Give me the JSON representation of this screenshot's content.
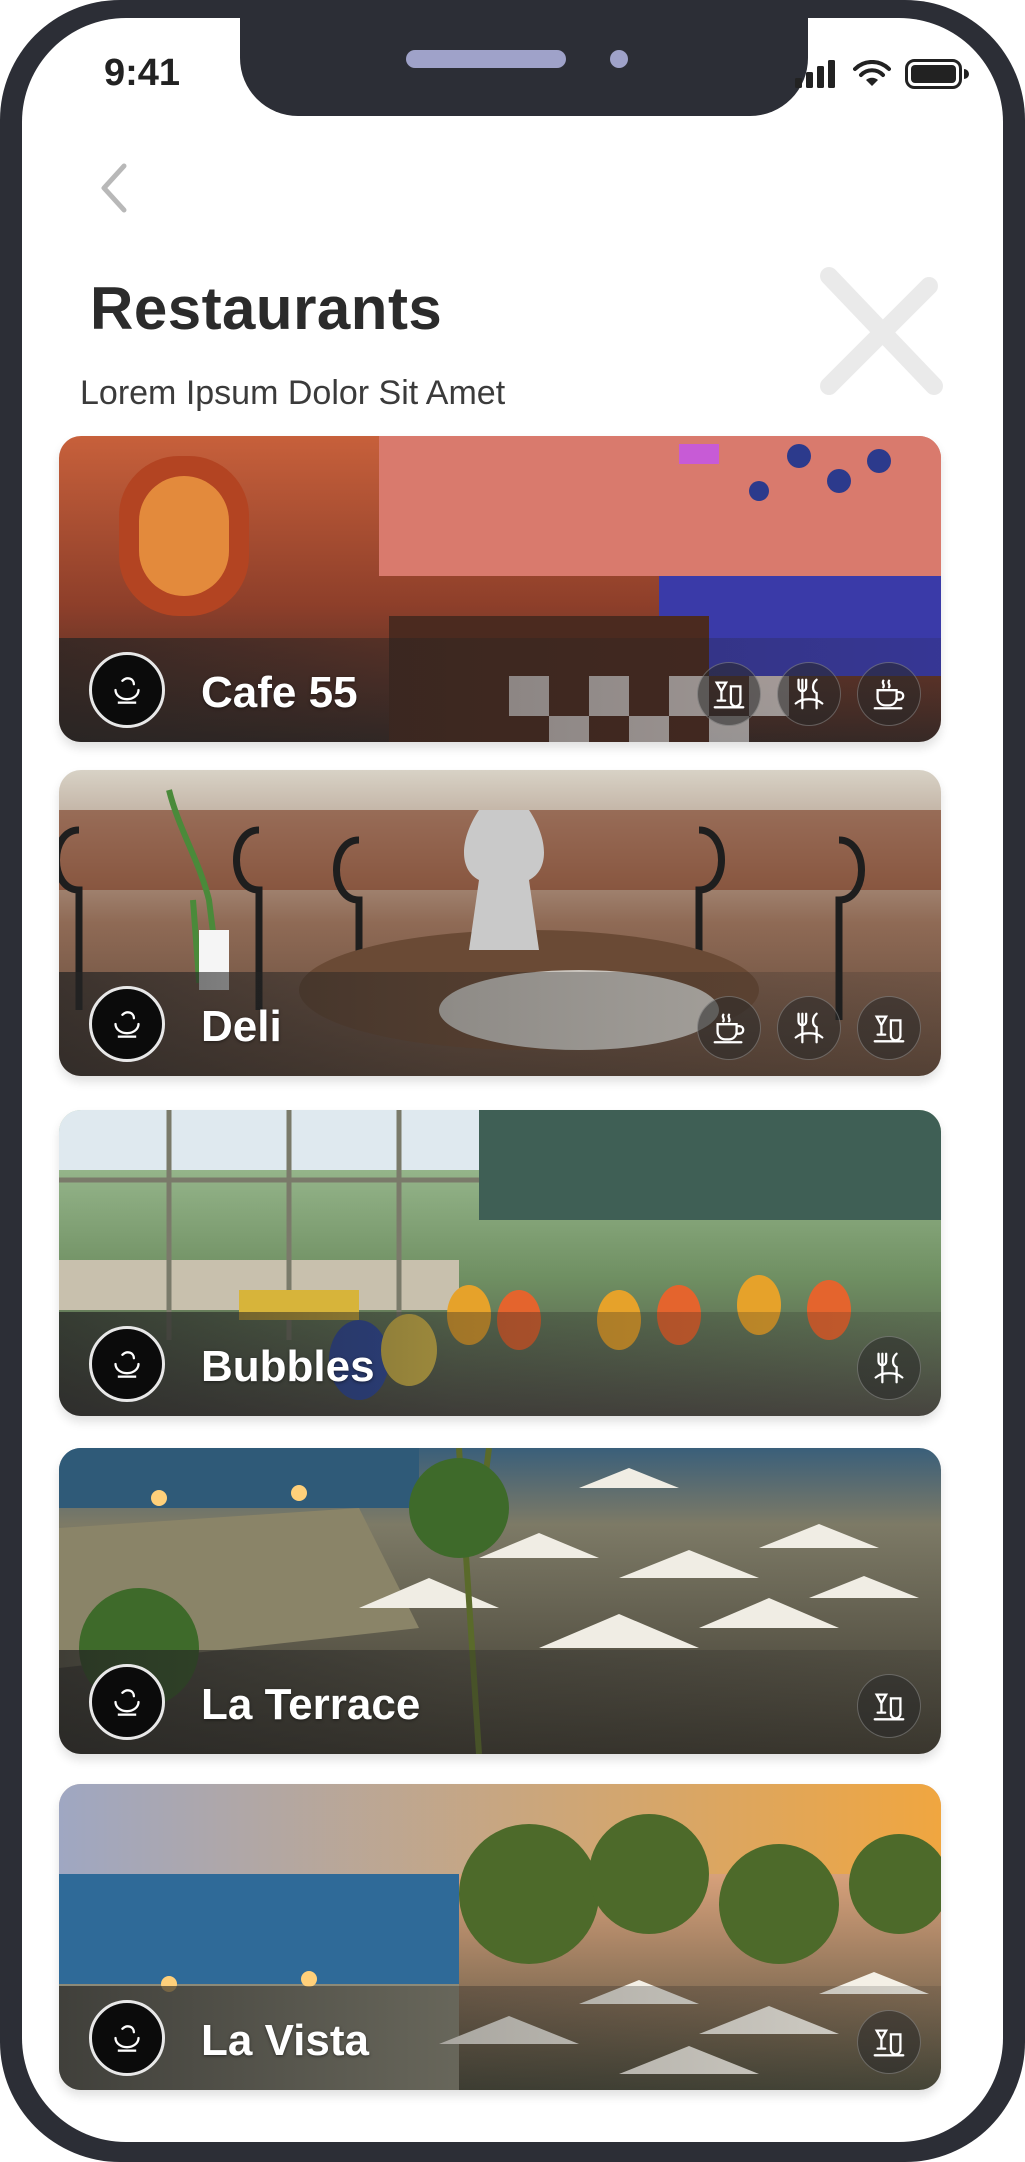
{
  "status_bar": {
    "time": "9:41"
  },
  "header": {
    "title": "Restaurants",
    "subtitle": "Lorem Ipsum Dolor Sit Amet"
  },
  "restaurants": [
    {
      "name": "Cafe 55",
      "features": [
        "bar-drinks-icon",
        "cutlery-icon",
        "coffee-icon"
      ]
    },
    {
      "name": "Deli",
      "features": [
        "coffee-icon",
        "cutlery-icon",
        "bar-drinks-icon"
      ]
    },
    {
      "name": "Bubbles",
      "features": [
        "cutlery-icon"
      ]
    },
    {
      "name": "La Terrace",
      "features": [
        "bar-drinks-icon"
      ]
    },
    {
      "name": "La Vista",
      "features": [
        "bar-drinks-icon"
      ]
    }
  ],
  "colors": {
    "device_frame": "#2c2e36",
    "title_text": "#2b2b2b",
    "card_text": "#ffffff"
  }
}
